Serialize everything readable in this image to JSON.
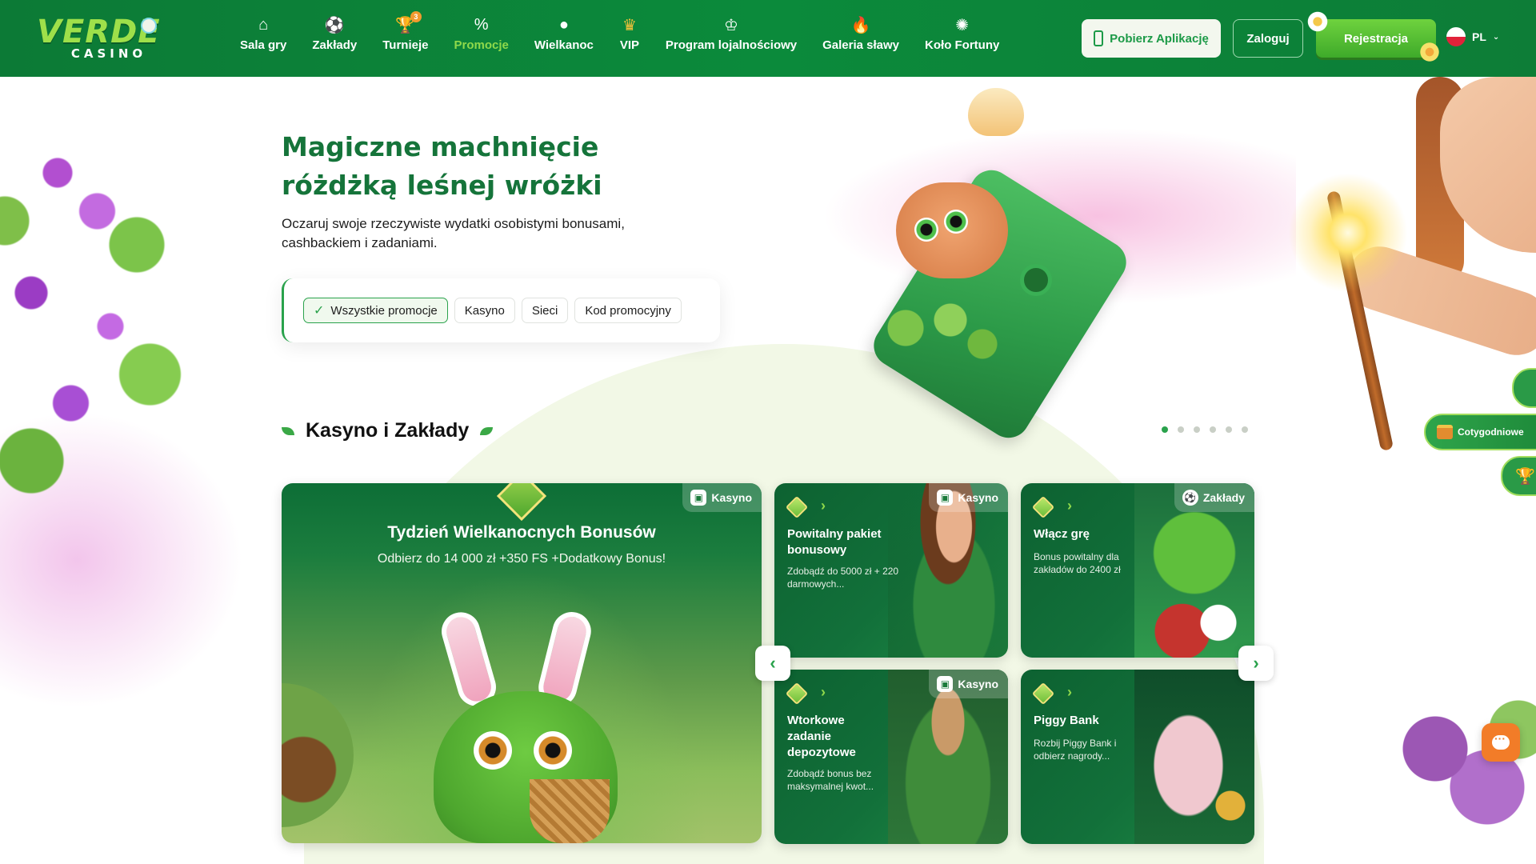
{
  "brand": {
    "logo_main": "VERDE",
    "logo_sub": "CASINO"
  },
  "nav": {
    "items": [
      {
        "label": "Sala gry",
        "icon": "house-icon",
        "glyph": "⌂"
      },
      {
        "label": "Zakłady",
        "icon": "soccer-ball-icon",
        "glyph": "⚽"
      },
      {
        "label": "Turnieje",
        "icon": "trophy-icon",
        "glyph": "🏆",
        "badge": "3"
      },
      {
        "label": "Promocje",
        "icon": "percent-badge-icon",
        "glyph": "%",
        "active": true
      },
      {
        "label": "Wielkanoc",
        "icon": "easter-egg-icon",
        "glyph": "●"
      },
      {
        "label": "VIP",
        "icon": "crown-icon",
        "glyph": "♛"
      },
      {
        "label": "Program lojalnościowy",
        "icon": "loyalty-crown-icon",
        "glyph": "♔"
      },
      {
        "label": "Galeria sławy",
        "icon": "flame-icon",
        "glyph": "🔥"
      },
      {
        "label": "Koło Fortuny",
        "icon": "fortune-wheel-icon",
        "glyph": "✺"
      }
    ]
  },
  "header": {
    "app_button": "Pobierz Aplikację",
    "login_button": "Zaloguj",
    "register_button": "Rejestracja",
    "language": "PL"
  },
  "hero": {
    "title_line1": "Magiczne machnięcie",
    "title_line2": "różdżką leśnej wróżki",
    "subtitle_line1": "Oczaruj swoje rzeczywiste wydatki osobistymi bonusami,",
    "subtitle_line2": "cashbackiem i zadaniami."
  },
  "filters": {
    "chips": [
      {
        "label": "Wszystkie promocje",
        "active": true
      },
      {
        "label": "Kasyno",
        "active": false
      },
      {
        "label": "Sieci",
        "active": false
      },
      {
        "label": "Kod promocyjny",
        "active": false
      }
    ]
  },
  "section": {
    "title": "Kasyno i Zakłady",
    "dots_count": 6,
    "active_dot": 0
  },
  "side_tabs": {
    "weekly": "Cotygodniowe"
  },
  "cards": {
    "big": {
      "tag": "Kasyno",
      "title": "Tydzień Wielkanocnych Bonusów",
      "subtitle": "Odbierz do 14 000 zł +350 FS +Dodatkowy Bonus!"
    },
    "small": [
      {
        "tag": "Kasyno",
        "title": "Powitalny pakiet bonusowy",
        "desc": "Zdobądź do 5000 zł + 220 darmowych..."
      },
      {
        "tag": "Zakłady",
        "title": "Włącz grę",
        "desc": "Bonus powitalny dla zakładów do 2400 zł"
      },
      {
        "tag": "Kasyno",
        "title": "Wtorkowe zadanie depozytowe",
        "desc": "Zdobądź bonus bez maksymalnej kwot..."
      },
      {
        "tag": "",
        "title": "Piggy Bank",
        "desc": "Rozbij Piggy Bank i odbierz nagrody..."
      }
    ]
  },
  "colors": {
    "header_green": "#0b8a3b",
    "accent_green": "#2aa24c",
    "active_nav": "#8fd94b",
    "title_green": "#15743a",
    "chat_orange": "#f27c28"
  }
}
